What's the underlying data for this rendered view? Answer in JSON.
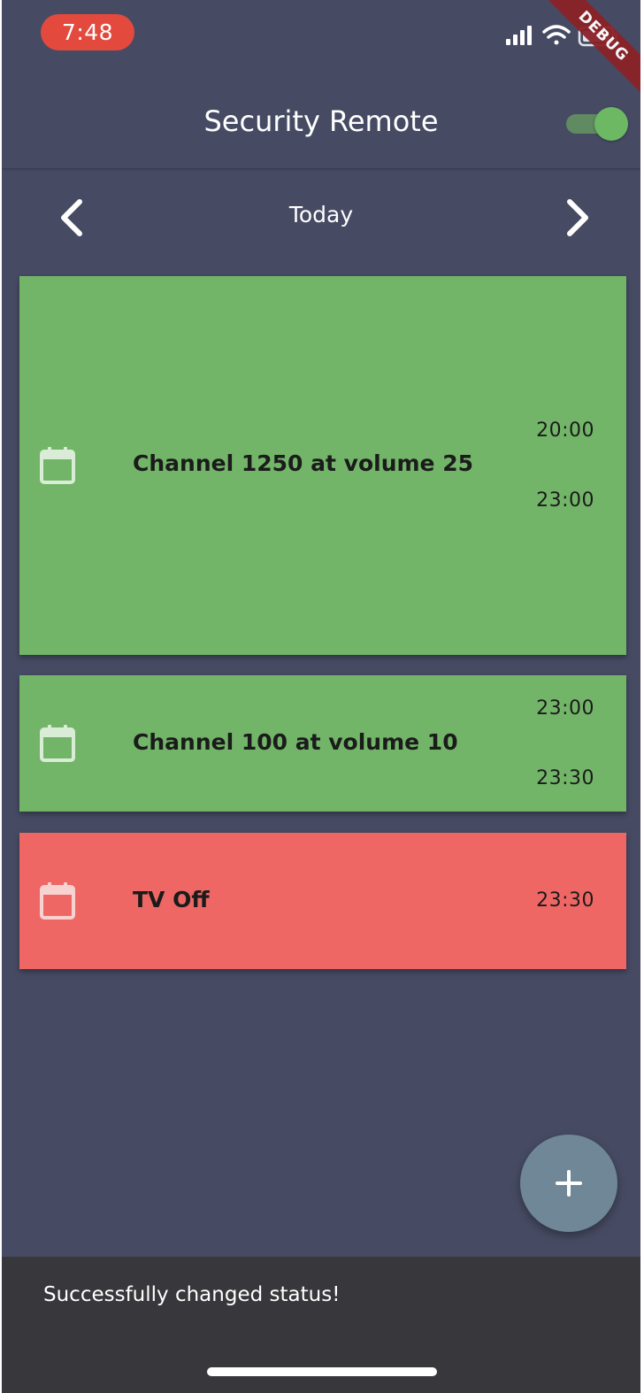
{
  "status_bar": {
    "time": "7:48",
    "debug_label": "DEBUG",
    "icons": [
      "signal-icon",
      "wifi-icon",
      "battery-icon"
    ]
  },
  "appbar": {
    "title": "Security Remote",
    "toggle_on": true
  },
  "date_nav": {
    "label": "Today",
    "prev_icon": "chevron-left-icon",
    "next_icon": "chevron-right-icon"
  },
  "schedule": [
    {
      "title": "Channel 1250 at volume 25",
      "start": "20:00",
      "end": "23:00",
      "color": "#72b568",
      "icon": "calendar-icon"
    },
    {
      "title": "Channel 100 at volume 10",
      "start": "23:00",
      "end": "23:30",
      "color": "#72b568",
      "icon": "calendar-icon"
    },
    {
      "title": "TV Off",
      "start": "23:30",
      "end": "",
      "color": "#ef6764",
      "icon": "calendar-icon"
    }
  ],
  "fab": {
    "icon": "plus-icon"
  },
  "snackbar": {
    "message": "Successfully changed status!"
  },
  "colors": {
    "background": "#464b63",
    "active": "#72b568",
    "off": "#ef6764",
    "fab": "#6f8797",
    "snackbar": "#38373b"
  }
}
